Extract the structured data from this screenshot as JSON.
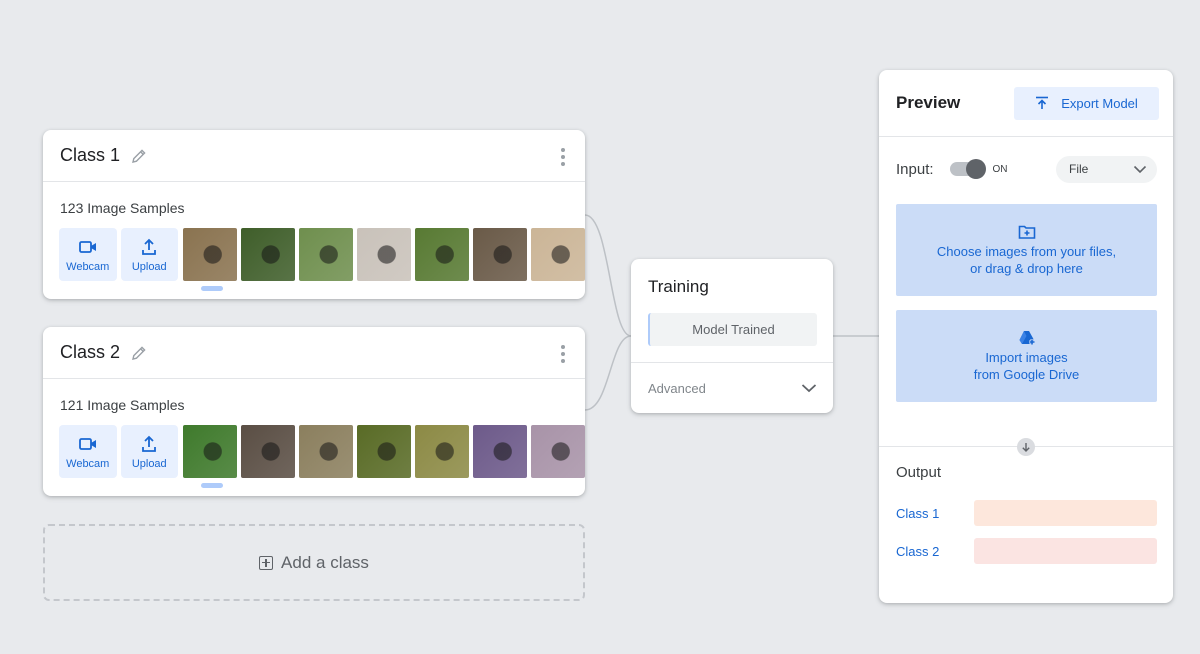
{
  "classes": [
    {
      "name": "Class 1",
      "samples": "123 Image Samples",
      "webcam_label": "Webcam",
      "upload_label": "Upload",
      "thumbs": [
        "#8a7350",
        "#3f5e2a",
        "#6f8f4e",
        "#c9c2ba",
        "#587a33",
        "#6a5a48",
        "#cbb597"
      ]
    },
    {
      "name": "Class 2",
      "samples": "121 Image Samples",
      "webcam_label": "Webcam",
      "upload_label": "Upload",
      "thumbs": [
        "#3f7a2c",
        "#5a4e44",
        "#8b7f5e",
        "#596b26",
        "#8c8a45",
        "#6d5a8a",
        "#a893a8"
      ]
    }
  ],
  "add_class_label": "Add a class",
  "training": {
    "title": "Training",
    "button_label": "Model Trained",
    "advanced_label": "Advanced"
  },
  "preview": {
    "title": "Preview",
    "export_label": "Export Model",
    "input_label": "Input:",
    "toggle_state": "ON",
    "source_select": "File",
    "drop_files_line1": "Choose images from your files,",
    "drop_files_line2": "or drag & drop here",
    "drive_line1": "Import images",
    "drive_line2": "from Google Drive",
    "output_title": "Output",
    "outputs": [
      {
        "label": "Class 1",
        "confidence": 0,
        "color": "#fde7dc"
      },
      {
        "label": "Class 2",
        "confidence": 0,
        "color": "#fbe4e2"
      }
    ]
  },
  "colors": {
    "accent": "#1967d2",
    "button_bg": "#e8f0fe",
    "drop_bg": "#cbdcf7"
  }
}
